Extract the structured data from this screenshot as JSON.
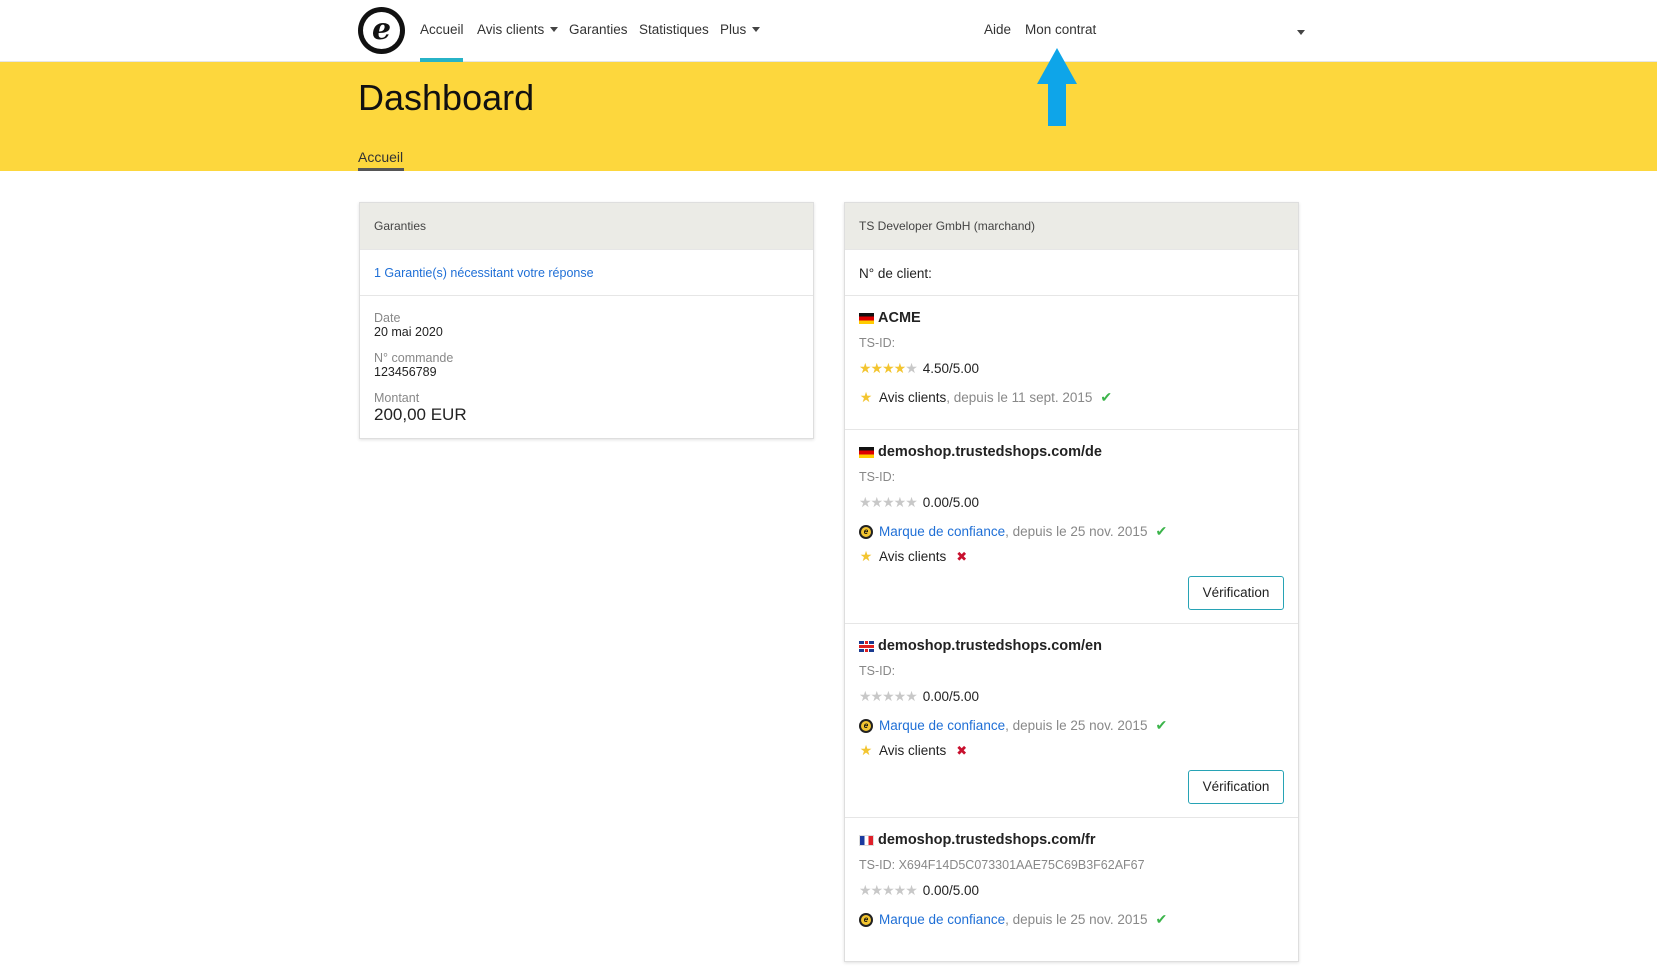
{
  "nav": {
    "logo_letter": "e",
    "items": [
      {
        "label": "Accueil"
      },
      {
        "label": "Avis clients"
      },
      {
        "label": "Garanties"
      },
      {
        "label": "Statistiques"
      },
      {
        "label": "Plus"
      }
    ],
    "help": "Aide",
    "contract": "Mon contrat"
  },
  "header": {
    "title": "Dashboard",
    "tab": "Accueil"
  },
  "guarantees": {
    "heading": "Garanties",
    "pending_link": "1 Garantie(s) nécessitant votre réponse",
    "date_label": "Date",
    "date_value": "20 mai 2020",
    "order_label": "N° commande",
    "order_value": "123456789",
    "amount_label": "Montant",
    "amount_value": "200,00 EUR"
  },
  "merchant": {
    "heading": "TS Developer GmbH (marchand)",
    "client_no_label": "N° de client:",
    "shops": [
      {
        "name": "ACME",
        "flag": "de",
        "tsid": "TS-ID:",
        "rating": "4.50/5.00",
        "stars_filled": 4.5,
        "reviews_label": "Avis clients",
        "reviews_since": ", depuis le 11 sept. 2015"
      },
      {
        "name": "demoshop.trustedshops.com/de",
        "flag": "de",
        "tsid": "TS-ID:",
        "rating": "0.00/5.00",
        "stars_filled": 0,
        "trustmark_label": "Marque de confiance",
        "trustmark_since": ", depuis le 25 nov. 2015",
        "reviews_label": "Avis clients",
        "button": "Vérification"
      },
      {
        "name": "demoshop.trustedshops.com/en",
        "flag": "gb",
        "tsid": "TS-ID:",
        "rating": "0.00/5.00",
        "stars_filled": 0,
        "trustmark_label": "Marque de confiance",
        "trustmark_since": ", depuis le 25 nov. 2015",
        "reviews_label": "Avis clients",
        "button": "Vérification"
      },
      {
        "name": "demoshop.trustedshops.com/fr",
        "flag": "fr",
        "tsid": "TS-ID: X694F14D5C073301AAE75C69B3F62AF67",
        "rating": "0.00/5.00",
        "stars_filled": 0,
        "trustmark_label": "Marque de confiance",
        "trustmark_since": ", depuis le 25 nov. 2015"
      }
    ]
  },
  "colors": {
    "header_yellow": "#fdd73d",
    "active_accent": "#27b3c7",
    "link_blue": "#1f6fd6",
    "annotation_arrow": "#0ea5e9",
    "check_green": "#3bb44a",
    "cross_red": "#c8102e"
  }
}
